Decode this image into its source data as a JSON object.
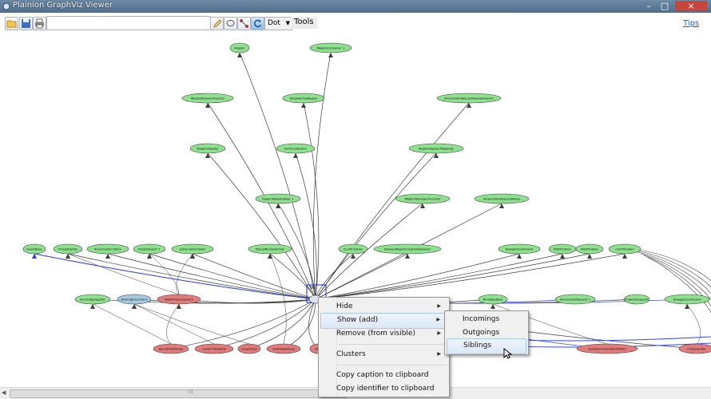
{
  "window": {
    "title": "Plainion GraphViz Viewer",
    "controls": [
      "–",
      "□",
      "×"
    ]
  },
  "toolbar": {
    "search_value": "",
    "layout_engine": "Dot",
    "tools_label": "Tools",
    "tips_label": "Tips",
    "icons": [
      "open-folder-icon",
      "save-icon",
      "print-icon",
      "edit-icon",
      "lasso-icon",
      "nodes-icon",
      "refresh-icon"
    ]
  },
  "graph": {
    "nodes": [
      {
        "label": "IRegion",
        "color": "green"
      },
      {
        "label": "IRegionContainer`1",
        "color": "green"
      },
      {
        "label": "IRegionBehaviorFactory",
        "color": "green"
      },
      {
        "label": "SingleActiveRegion",
        "color": "green"
      },
      {
        "label": "IInteractionRequestAwareBehavior",
        "color": "green"
      },
      {
        "label": "IRegionAdapter",
        "color": "green"
      },
      {
        "label": "ItemsCollection",
        "color": "green"
      },
      {
        "label": "RegionAdapterMappings",
        "color": "green"
      },
      {
        "label": "RegionAdapterBase`1",
        "color": "green"
      },
      {
        "label": "IRegionManagerAccessor",
        "color": "green"
      },
      {
        "label": "IInteractionRequestAware",
        "color": "green"
      },
      {
        "label": "EventBase",
        "color": "green"
      },
      {
        "label": "ThreadOption",
        "color": "green"
      },
      {
        "label": "IEventSubscription",
        "color": "green"
      },
      {
        "label": "PubSubEvent`1",
        "color": "green"
      },
      {
        "label": "SubscriptionToken",
        "color": "green"
      },
      {
        "label": "PopupWindowAction",
        "color": "green"
      },
      {
        "label": "IConfirmation",
        "color": "green"
      },
      {
        "label": "DelayedRegionCreationBehavior",
        "color": "green"
      },
      {
        "label": "DelegateCommand",
        "color": "green"
      },
      {
        "label": "INotification",
        "color": "green"
      },
      {
        "label": "INotification",
        "color": "green"
      },
      {
        "label": "Confirmation",
        "color": "green"
      },
      {
        "label": "IEventAggregator",
        "color": "green"
      },
      {
        "label": "BindingExtensions",
        "color": "blue"
      },
      {
        "label": "NotifyPropertyEvent",
        "color": "red"
      },
      {
        "label": "BindableBase",
        "color": "green"
      },
      {
        "label": "InteractionRequest`1",
        "color": "green"
      },
      {
        "label": "PropertySupport",
        "color": "green"
      },
      {
        "label": "DelegateCommand",
        "color": "green"
      },
      {
        "label": "BoundItemModel",
        "color": "red"
      },
      {
        "label": "ClusterTreeNode",
        "color": "red"
      },
      {
        "label": "GraphView",
        "color": "red"
      },
      {
        "label": "ViewModelBase",
        "color": "red"
      },
      {
        "label": "SaveDocumentationModel",
        "color": "red"
      },
      {
        "label": "ClusterEditor",
        "color": "red"
      },
      {
        "label": "Nod",
        "color": "red"
      }
    ],
    "selected_node": "NR"
  },
  "context_menu": {
    "items": [
      {
        "label": "Hide",
        "submenu": true
      },
      {
        "label": "Show (add)",
        "submenu": true
      },
      {
        "label": "Remove (from visible)",
        "submenu": true
      },
      {
        "label": "Clusters",
        "submenu": true
      },
      {
        "label": "Copy caption to clipboard",
        "submenu": false
      },
      {
        "label": "Copy identifier to clipboard",
        "submenu": false
      }
    ],
    "highlighted": "Show (add)"
  },
  "submenu": {
    "items": [
      {
        "label": "Incomings"
      },
      {
        "label": "Outgoings"
      },
      {
        "label": "Siblings"
      }
    ],
    "highlighted": "Siblings"
  },
  "colors": {
    "node_green": "#8fe08f",
    "node_blue": "#a6cbe0",
    "node_red": "#e27b7b",
    "edge": "#3d3d3d",
    "edge_blue": "#3346e6",
    "selection": "#1a2bd0"
  }
}
